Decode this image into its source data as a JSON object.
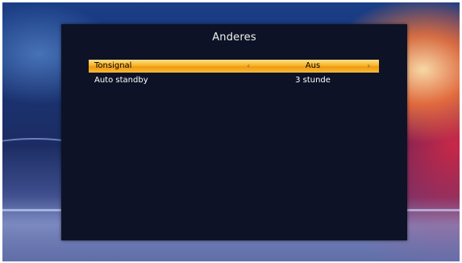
{
  "panel": {
    "title": "Anderes"
  },
  "menu": {
    "items": [
      {
        "label": "Tonsignal",
        "value": "Aus",
        "selected": true
      },
      {
        "label": "Auto standby",
        "value": "3 stunde",
        "selected": false
      }
    ]
  },
  "icons": {
    "left_arrow": "chevron-left-icon",
    "right_arrow": "chevron-right-icon"
  },
  "colors": {
    "highlight": "#f5b02a",
    "panel_background": "#0d1226",
    "text": "#ffffff"
  }
}
